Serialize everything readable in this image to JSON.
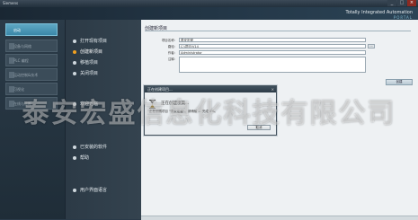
{
  "window": {
    "title": "Siemens",
    "controls": [
      "_",
      "□",
      "×"
    ]
  },
  "branding": {
    "line1": "Totally Integrated Automation",
    "line2": "PORTAL"
  },
  "left_nav": {
    "items": [
      {
        "label": "启动",
        "active": true
      },
      {
        "label": "设备与网络",
        "active": false
      },
      {
        "label": "PLC 编程",
        "active": false
      },
      {
        "label": "运动控制&技术",
        "active": false
      },
      {
        "label": "可视化",
        "active": false
      },
      {
        "label": "在线与诊断",
        "active": false
      }
    ]
  },
  "menu": {
    "items": [
      {
        "label": "打开现有项目",
        "selected": false
      },
      {
        "label": "创建新项目",
        "selected": true
      },
      {
        "label": "移植项目",
        "selected": false
      },
      {
        "label": "关闭项目",
        "selected": false
      },
      {
        "label": "欢迎光临",
        "selected": false
      },
      {
        "label": "已安装的软件",
        "selected": false
      },
      {
        "label": "帮助",
        "selected": false
      },
      {
        "label": "用户界面语言",
        "selected": false
      }
    ]
  },
  "form": {
    "section_title": "创建新项目",
    "project_name_label": "项目名称:",
    "project_name_value": "泰安宏盛",
    "path_label": "路径:",
    "path_value": "C:\\项目\\V14",
    "author_label": "作者:",
    "author_value": "Administrator",
    "comment_label": "注释:",
    "comment_value": "",
    "browse_label": "...",
    "create_button": "创建"
  },
  "dialog": {
    "title": "正在创建项目...",
    "close": "×",
    "message": "正在创建项目...",
    "sub_message": "正在创建项目 \"泰安宏盛\"，请稍候 ... 完成 0%。",
    "cancel_button": "取消"
  },
  "watermark": "泰安宏盛信息化科技有限公司",
  "colors": {
    "accent": "#3a87a8",
    "selected_bullet": "#f0a020"
  }
}
